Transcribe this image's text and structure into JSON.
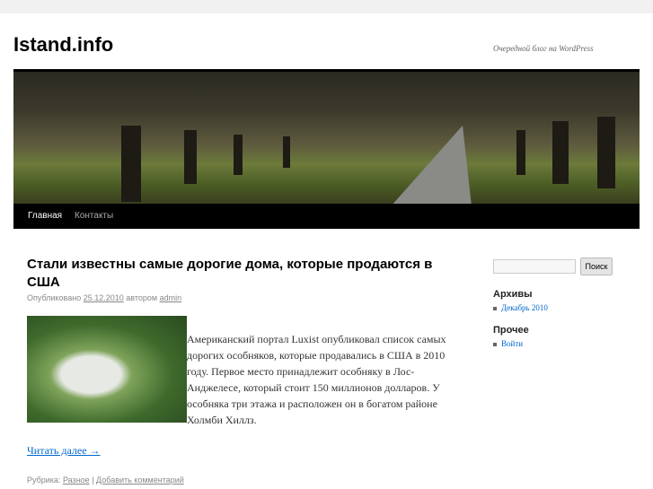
{
  "site": {
    "title": "Istand.info",
    "description": "Очередной блог на WordPress"
  },
  "nav": [
    "Главная",
    "Контакты"
  ],
  "post": {
    "title": "Стали известны самые дорогие дома, которые продаются в США",
    "meta_prefix": "Опубликовано",
    "date": "25.12.2010",
    "by": "автором",
    "author": "admin",
    "body": "Американский портал Luxist опубликовал список самых дорогих особняков, которые продавались в США в 2010 году. Первое место принадлежит особняку в Лос-Анджелесе, который стоит 150 миллионов долларов. У особняка три этажа и расположен он в богатом районе Холмби Хиллз.",
    "read_more": "Читать далее →",
    "category_label": "Рубрика:",
    "category": "Разное",
    "separator": "|",
    "comment": "Добавить комментарий"
  },
  "sidebar": {
    "search_button": "Поиск",
    "archives_title": "Архивы",
    "archives": [
      "Декабрь 2010"
    ],
    "other_title": "Прочее",
    "other": [
      "Войти"
    ]
  }
}
